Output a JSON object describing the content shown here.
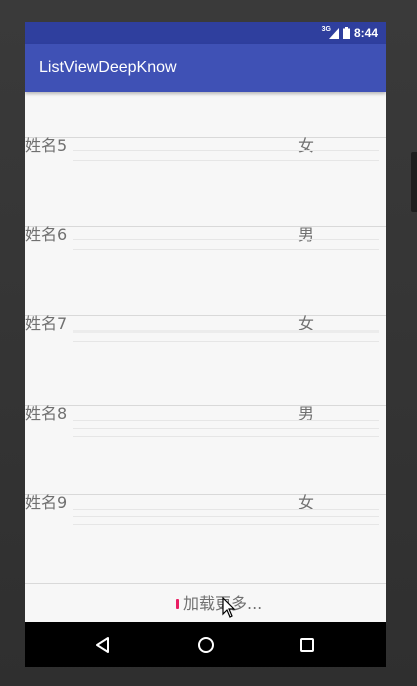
{
  "status_bar": {
    "network": "3G",
    "time": "8:44"
  },
  "app_bar": {
    "title": "ListViewDeepKnow"
  },
  "list": {
    "items": [
      {
        "name": "姓名5",
        "gender": "女"
      },
      {
        "name": "姓名6",
        "gender": "男"
      },
      {
        "name": "姓名7",
        "gender": "女"
      },
      {
        "name": "姓名8",
        "gender": "男"
      },
      {
        "name": "姓名9",
        "gender": "女"
      }
    ]
  },
  "footer": {
    "loading_text": "加载更多..."
  },
  "nav_bar": {
    "back_icon": "back-triangle-icon",
    "home_icon": "home-circle-icon",
    "recents_icon": "recents-square-icon"
  },
  "colors": {
    "status_bar": "#2f3f9e",
    "app_bar": "#3f51b5",
    "progress_accent": "#e91e63",
    "background": "#f7f7f7"
  }
}
